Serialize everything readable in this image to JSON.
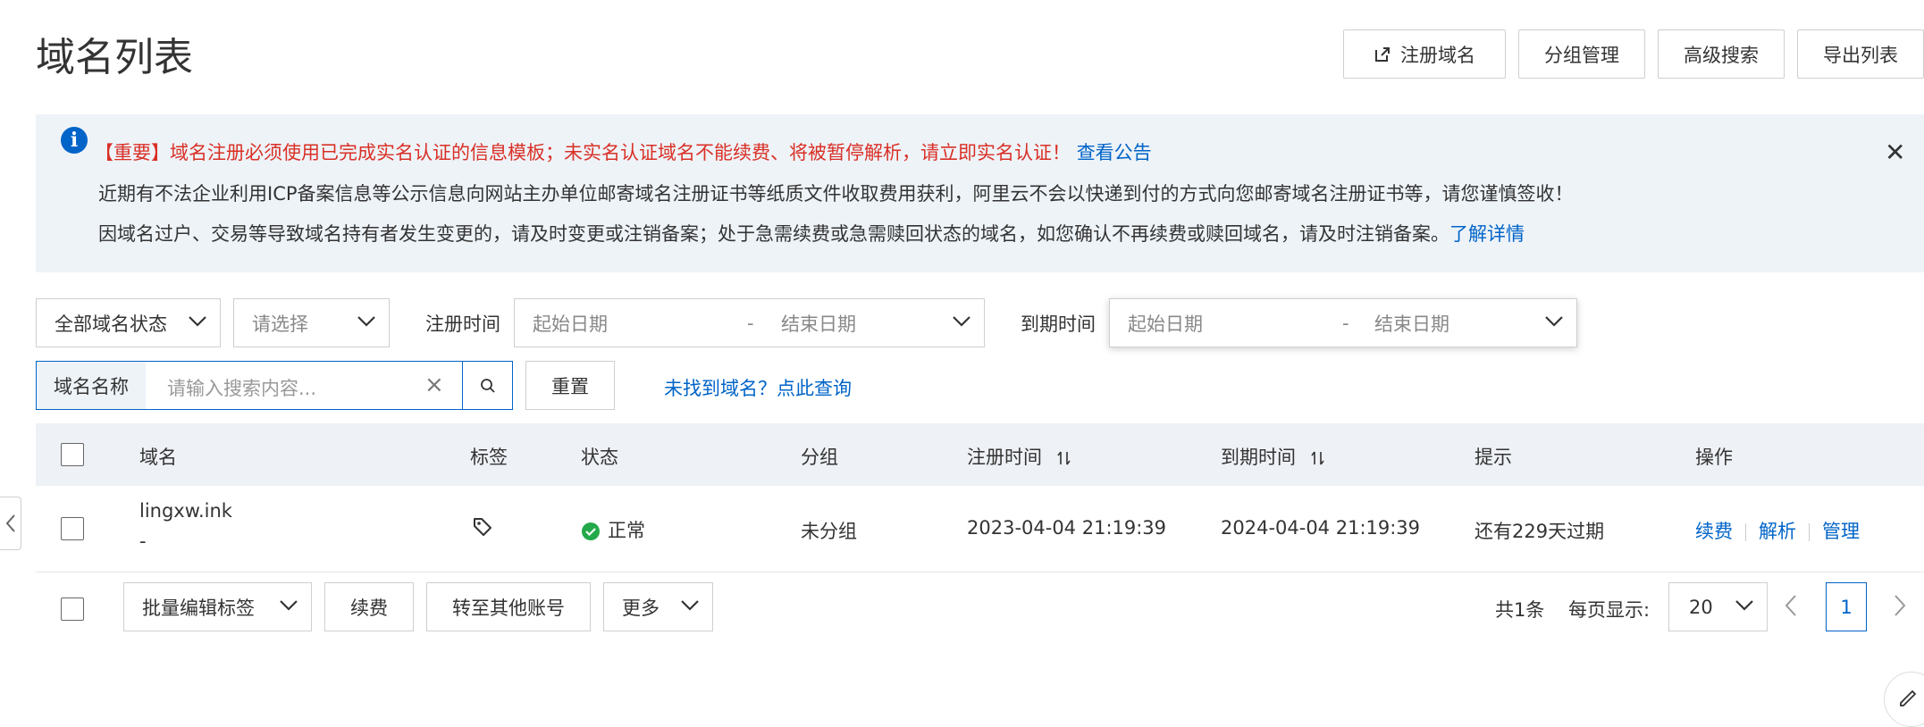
{
  "page_title": "域名列表",
  "header_buttons": {
    "register": "注册域名",
    "group_manage": "分组管理",
    "advanced_search": "高级搜索",
    "export_list": "导出列表"
  },
  "notice": {
    "line1_important": "【重要】域名注册必须使用已完成实名认证的信息模板；未实名认证域名不能续费、将被暂停解析，请立即实名认证！",
    "line1_link": "查看公告",
    "line2": "近期有不法企业利用ICP备案信息等公示信息向网站主办单位邮寄域名注册证书等纸质文件收取费用获利，阿里云不会以快递到付的方式向您邮寄域名注册证书等，请您谨慎签收！",
    "line3": "因域名过户、交易等导致域名持有者发生变更的，请及时变更或注销备案；处于急需续费或急需赎回状态的域名，如您确认不再续费或赎回域名，请及时注销备案。",
    "line3_link": "了解详情"
  },
  "filters": {
    "status_select": "全部域名状态",
    "please_select": "请选择",
    "reg_time_label": "注册时间",
    "reg_start_placeholder": "起始日期",
    "reg_end_placeholder": "结束日期",
    "exp_time_label": "到期时间",
    "exp_start_placeholder": "起始日期",
    "exp_end_placeholder": "结束日期",
    "date_separator": "-",
    "search_field_label": "域名名称",
    "search_placeholder": "请输入搜索内容...",
    "reset_button": "重置",
    "not_found_link": "未找到域名？点此查询"
  },
  "table": {
    "headers": {
      "domain": "域名",
      "tag": "标签",
      "status": "状态",
      "group": "分组",
      "reg_time": "注册时间",
      "exp_time": "到期时间",
      "hint": "提示",
      "action": "操作"
    },
    "rows": [
      {
        "domain": "lingxw.ink",
        "sub": "-",
        "status": "正常",
        "group": "未分组",
        "reg_time": "2023-04-04 21:19:39",
        "exp_time": "2024-04-04 21:19:39",
        "hint": "还有229天过期",
        "actions": [
          "续费",
          "解析",
          "管理"
        ]
      }
    ]
  },
  "bulk": {
    "edit_tags": "批量编辑标签",
    "renew": "续费",
    "transfer": "转至其他账号",
    "more": "更多"
  },
  "pagination": {
    "total": "共1条",
    "per_page_label": "每页显示:",
    "per_page_value": "20",
    "current_page": "1"
  },
  "colors": {
    "link_blue": "#0064c8",
    "alert_red": "#d93026",
    "status_green": "#23a94a",
    "notice_bg": "#eef3f8"
  }
}
